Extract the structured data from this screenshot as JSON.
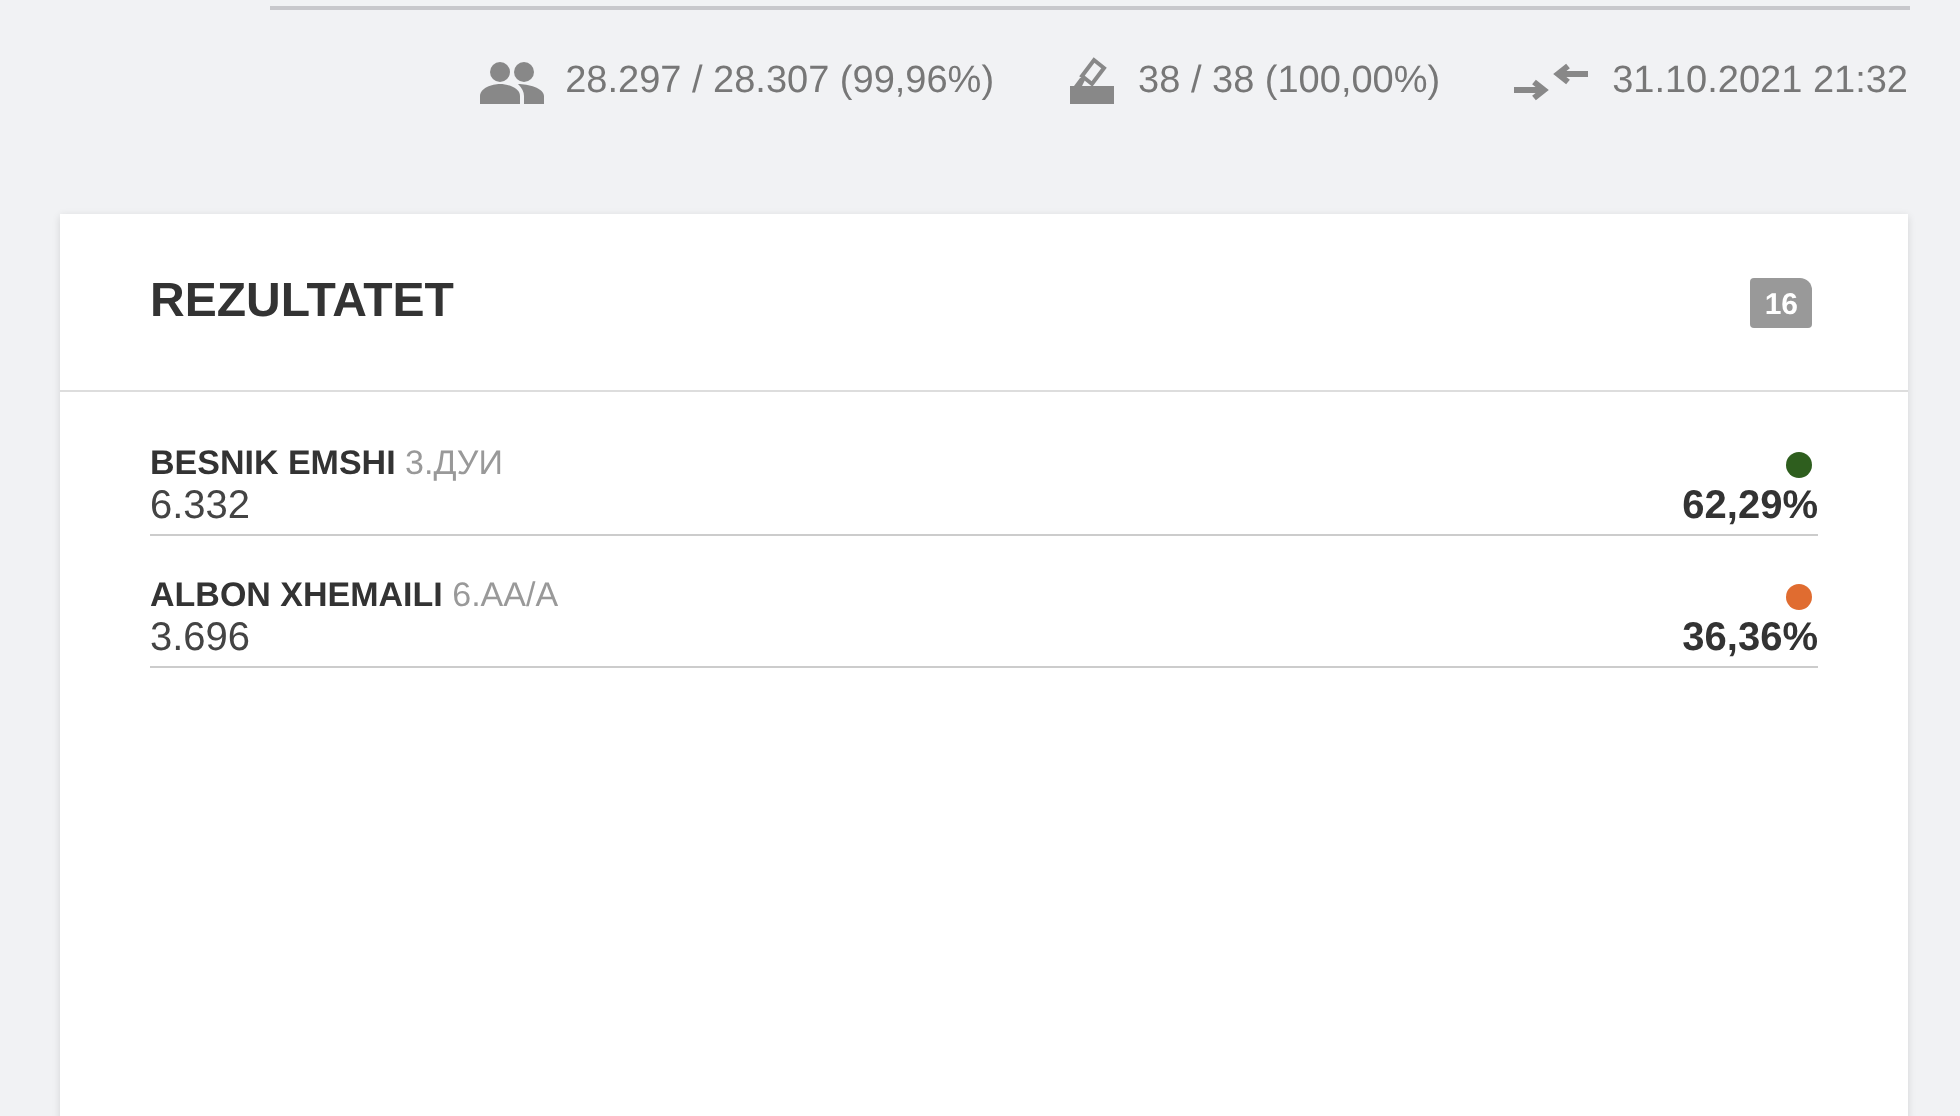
{
  "stats": [
    {
      "kind": "voters",
      "text": "28.297 / 28.307 (99,96%)"
    },
    {
      "kind": "ballot",
      "text": "38 / 38 (100,00%)"
    },
    {
      "kind": "updated",
      "text": "31.10.2021 21:32"
    }
  ],
  "card": {
    "title": "REZULTATET",
    "badge": "16",
    "candidates": [
      {
        "name": "BESNIK EMSHI",
        "party": "3.ДУИ",
        "votes": "6.332",
        "percent": "62,29%",
        "color": "#2e5e1e"
      },
      {
        "name": "ALBON XHEMAILI",
        "party": "6.АА/А",
        "votes": "3.696",
        "percent": "36,36%",
        "color": "#e06c30"
      }
    ]
  }
}
